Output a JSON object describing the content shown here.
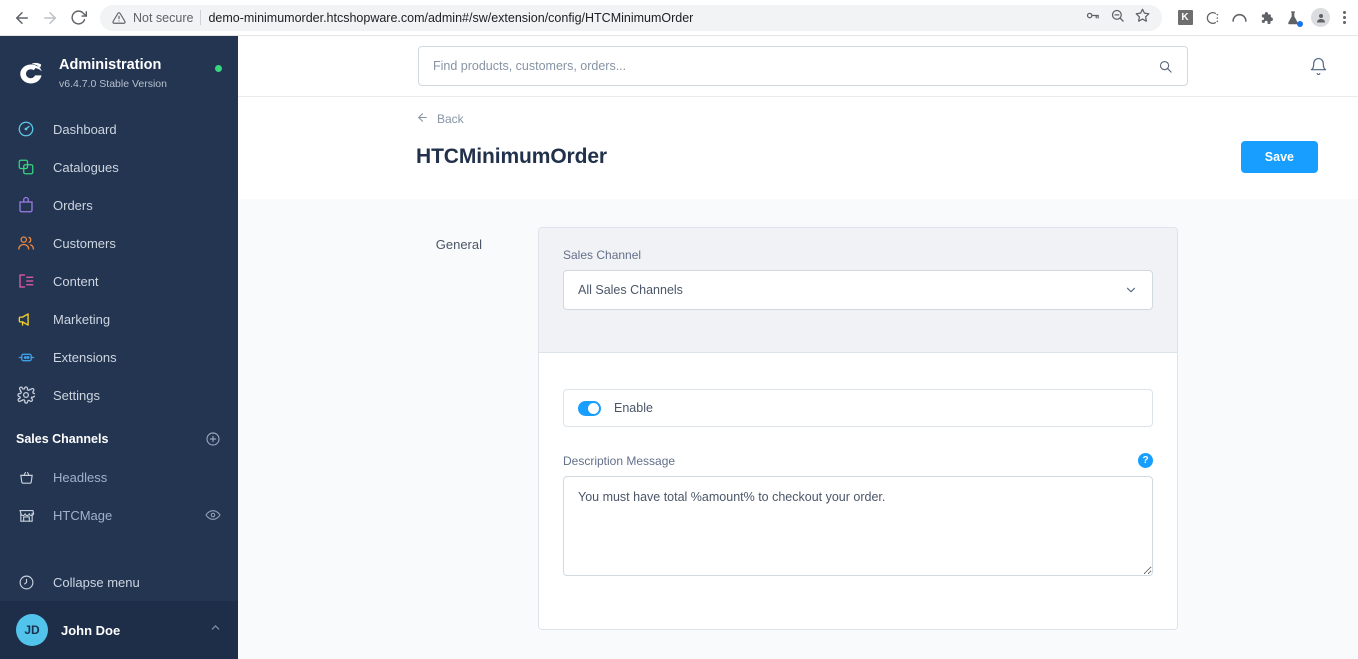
{
  "browser": {
    "security_label": "Not secure",
    "url": "demo-minimumorder.htcshopware.com/admin#/sw/extension/config/HTCMinimumOrder",
    "back_icon": "back-arrow-icon",
    "forward_icon": "forward-arrow-icon",
    "reload_icon": "reload-icon",
    "warning_icon": "warning-triangle-icon",
    "extensions": [
      {
        "name": "k-extension-icon",
        "label": "K"
      },
      {
        "name": "c-extension-icon",
        "label": "C"
      },
      {
        "name": "arch-extension-icon",
        "label": ""
      },
      {
        "name": "puzzle-extension-icon",
        "label": ""
      },
      {
        "name": "flask-extension-icon",
        "label": ""
      }
    ]
  },
  "sidebar": {
    "title": "Administration",
    "version": "v6.4.7.0 Stable Version",
    "status_color": "#37d57f",
    "items": [
      {
        "label": "Dashboard",
        "icon": "dashboard-icon",
        "color": "#5ec8e8"
      },
      {
        "label": "Catalogues",
        "icon": "catalogues-icon",
        "color": "#37d57f"
      },
      {
        "label": "Orders",
        "icon": "orders-icon",
        "color": "#9c7ce8"
      },
      {
        "label": "Customers",
        "icon": "customers-icon",
        "color": "#f2883c"
      },
      {
        "label": "Content",
        "icon": "content-icon",
        "color": "#ec5ca8"
      },
      {
        "label": "Marketing",
        "icon": "marketing-icon",
        "color": "#f5d228"
      },
      {
        "label": "Extensions",
        "icon": "extensions-icon",
        "color": "#3f9fe8"
      },
      {
        "label": "Settings",
        "icon": "settings-icon",
        "color": "#c5cdd8"
      }
    ],
    "sales_channels_title": "Sales Channels",
    "add_channel_icon": "plus-circle-icon",
    "channels": [
      {
        "label": "Headless",
        "icon": "basket-icon",
        "has_eye": false
      },
      {
        "label": "HTCMage",
        "icon": "storefront-icon",
        "has_eye": true
      }
    ],
    "collapse_label": "Collapse menu",
    "collapse_icon": "collapse-clock-icon",
    "user_name": "John Doe",
    "user_initials": "JD"
  },
  "topbar": {
    "search_placeholder": "Find products, customers, orders...",
    "search_value": "",
    "search_icon": "search-icon",
    "notification_icon": "bell-icon"
  },
  "page": {
    "back_label": "Back",
    "back_icon": "back-arrow-icon",
    "title": "HTCMinimumOrder",
    "save_label": "Save",
    "save_color": "#189eff"
  },
  "form": {
    "section_label": "General",
    "sales_channel_label": "Sales Channel",
    "sales_channel_value": "All Sales Channels",
    "sales_channel_caret": "chevron-down-icon",
    "enable_label": "Enable",
    "enable_on": true,
    "description_label": "Description Message",
    "description_help_icon": "help-circle-icon",
    "description_value": "You must have total %amount% to checkout your order."
  }
}
